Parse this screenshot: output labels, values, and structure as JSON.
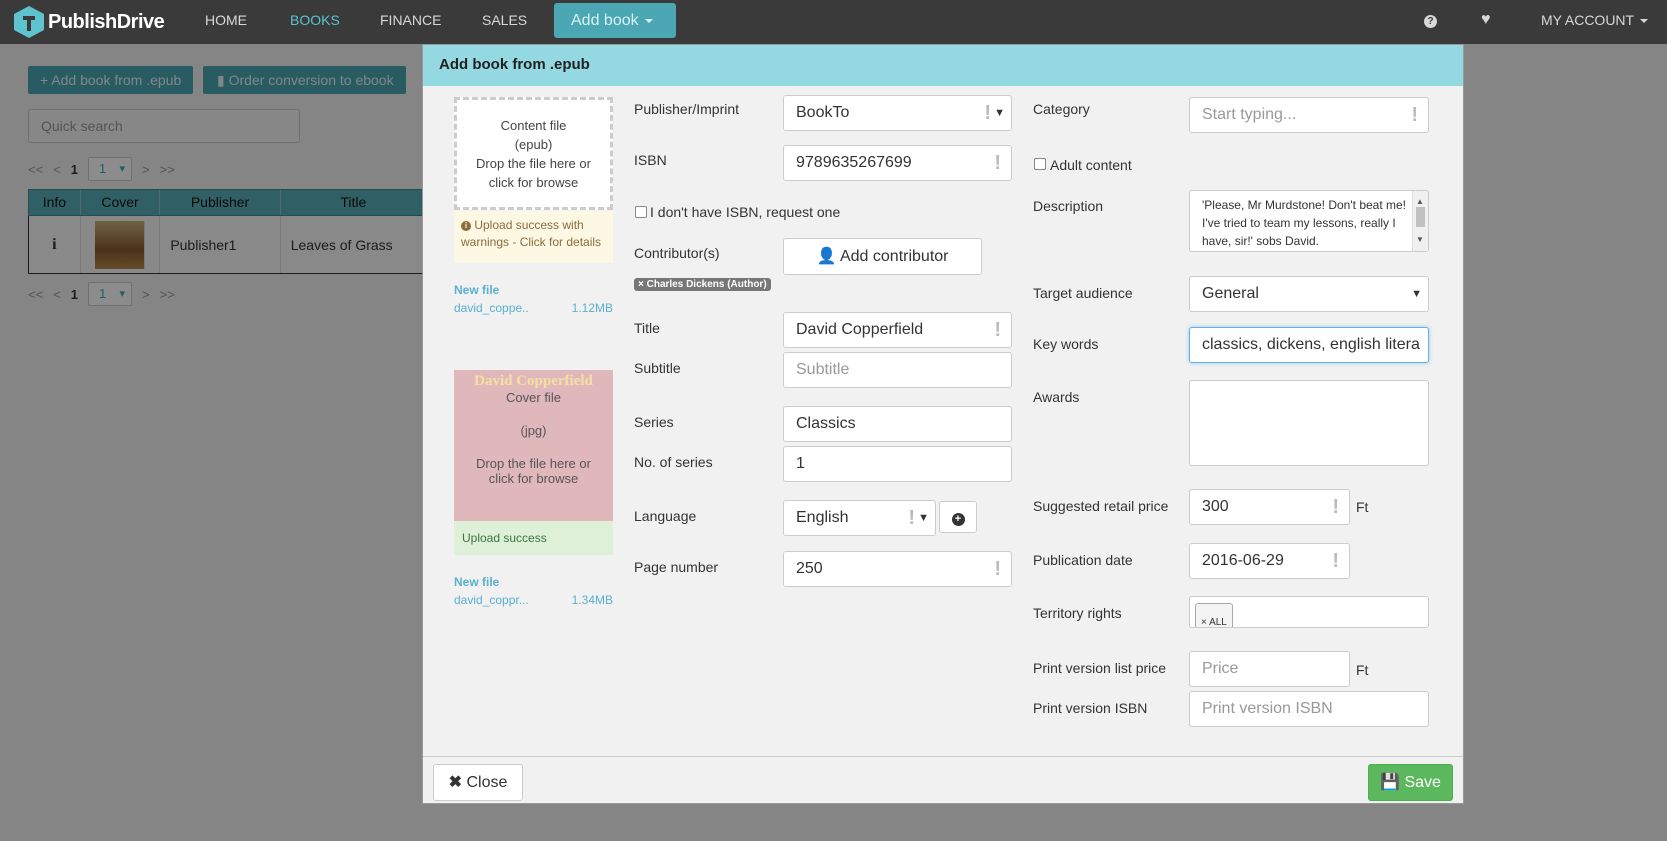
{
  "navbar": {
    "brand": "PublishDrive",
    "items": [
      "HOME",
      "BOOKS",
      "FINANCE",
      "SALES"
    ],
    "add_book": "Add book",
    "help_icon": "?",
    "account": "MY ACCOUNT"
  },
  "page": {
    "add_epub_button": "+ Add book from .epub",
    "order_conversion_button": "Order conversion to ebook",
    "quick_search_placeholder": "Quick search",
    "pager": {
      "first": "<<",
      "prev": "<",
      "current": "1",
      "select": "1",
      "next": ">",
      "last": ">>"
    },
    "table": {
      "headers": [
        "Info",
        "Cover",
        "Publisher",
        "Title"
      ],
      "row": {
        "info": "i",
        "publisher": "Publisher1",
        "title": "Leaves of Grass"
      }
    }
  },
  "modal": {
    "title": "Add book from .epub",
    "content_file": {
      "line1": "Content file",
      "line2": "(epub)",
      "line3": "Drop the file here or",
      "line4": "click for browse"
    },
    "warning": "Upload success with warnings - Click for details",
    "file1": {
      "label": "New file",
      "name": "david_coppe..",
      "size": "1.12MB"
    },
    "cover_file": {
      "cover_title": "David Copperfield",
      "line1": "Cover file",
      "line2": "(jpg)",
      "line3": "Drop the file here or",
      "line4": "click for browse"
    },
    "upload_success": "Upload success",
    "file2": {
      "label": "New file",
      "name": "david_coppr...",
      "size": "1.34MB"
    },
    "fields": {
      "publisher_label": "Publisher/Imprint",
      "publisher_value": "BookTo",
      "isbn_label": "ISBN",
      "isbn_value": "9789635267699",
      "no_isbn_label": "I don't have ISBN, request one",
      "contributors_label": "Contributor(s)",
      "add_contributor": "Add contributor",
      "contributor_tag": "Charles Dickens (Author)",
      "title_label": "Title",
      "title_value": "David Copperfield",
      "subtitle_label": "Subtitle",
      "subtitle_placeholder": "Subtitle",
      "series_label": "Series",
      "series_value": "Classics",
      "series_no_label": "No. of series",
      "series_no_value": "1",
      "language_label": "Language",
      "language_value": "English",
      "page_number_label": "Page number",
      "page_number_value": "250",
      "category_label": "Category",
      "category_placeholder": "Start typing...",
      "adult_label": "Adult content",
      "description_label": "Description",
      "description_value": "'Please, Mr Murdstone! Don't beat me! I've tried to team my lessons, really I have, sir!' sobs David.",
      "audience_label": "Target audience",
      "audience_value": "General",
      "keywords_label": "Key words",
      "keywords_value": "classics, dickens, english litera",
      "awards_label": "Awards",
      "price_label": "Suggested retail price",
      "price_value": "300",
      "currency": "Ft",
      "pubdate_label": "Publication date",
      "pubdate_value": "2016-06-29",
      "territory_label": "Territory rights",
      "territory_tag": "ALL",
      "print_price_label": "Print version list price",
      "print_price_placeholder": "Price",
      "print_isbn_label": "Print version ISBN",
      "print_isbn_placeholder": "Print version ISBN"
    },
    "close_button": "Close",
    "save_button": "Save"
  },
  "colors": {
    "accent": "#4aa7b3",
    "header": "#94d9e1",
    "save": "#5cb85c",
    "navbar": "#3a3a3a"
  }
}
